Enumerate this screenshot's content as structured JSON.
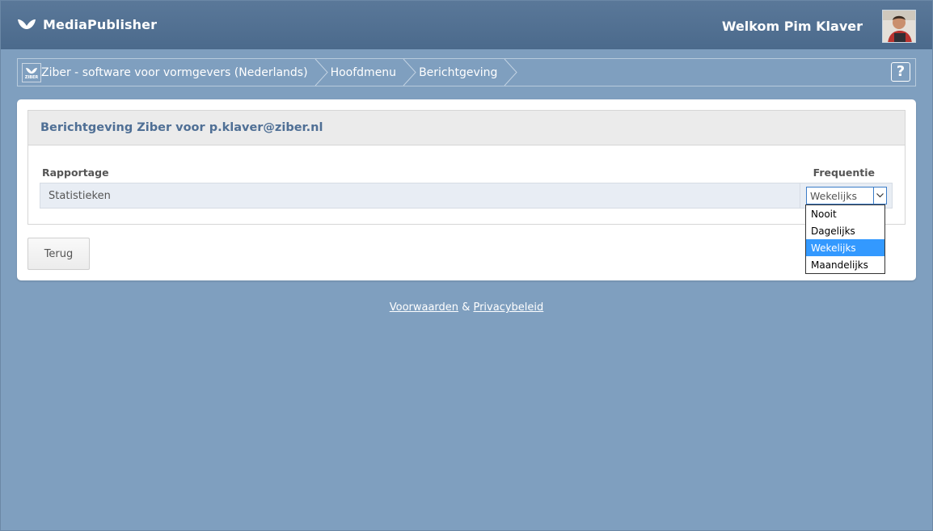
{
  "app": {
    "brand_name": "MediaPublisher",
    "welcome": "Welkom Pim Klaver",
    "logo_icon": "bird-icon",
    "avatar_icon": "user-avatar"
  },
  "breadcrumb": {
    "logo_text": "ZIBER",
    "items": [
      {
        "label": "Ziber - software voor vormgevers (Nederlands)"
      },
      {
        "label": "Hoofdmenu"
      },
      {
        "label": "Berichtgeving"
      }
    ],
    "help_label": "?"
  },
  "panel": {
    "title": "Berichtgeving Ziber voor p.klaver@ziber.nl",
    "columns": {
      "rapportage": "Rapportage",
      "frequentie": "Frequentie"
    },
    "rows": [
      {
        "label": "Statistieken",
        "frequency": "Wekelijks"
      }
    ],
    "frequency_options": [
      "Nooit",
      "Dagelijks",
      "Wekelijks",
      "Maandelijks"
    ],
    "selected_option": "Wekelijks"
  },
  "actions": {
    "back_label": "Terug"
  },
  "footer": {
    "terms_label": "Voorwaarden",
    "separator": "&",
    "privacy_label": "Privacybeleid"
  },
  "colors": {
    "background": "#7f9fbf",
    "topbar": "#4b6a8c",
    "title_text": "#4f6f95",
    "selected_option": "#3399ff"
  }
}
